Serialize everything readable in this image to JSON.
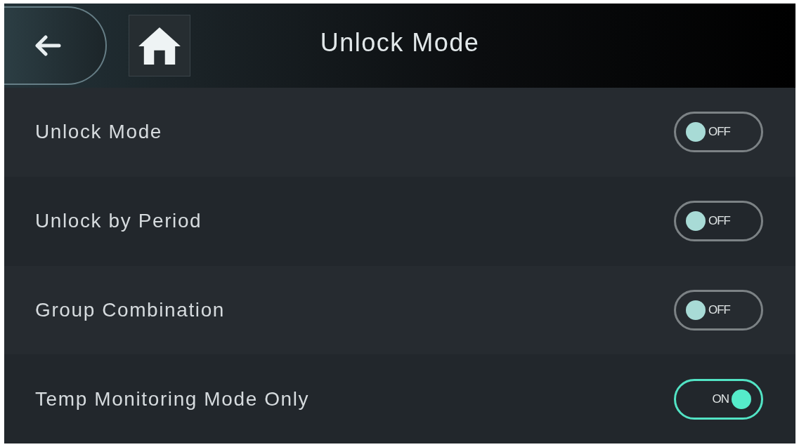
{
  "header": {
    "title": "Unlock Mode"
  },
  "rows": [
    {
      "label": "Unlock Mode",
      "on": false,
      "toggle_text": "OFF"
    },
    {
      "label": "Unlock by Period",
      "on": false,
      "toggle_text": "OFF"
    },
    {
      "label": "Group Combination",
      "on": false,
      "toggle_text": "OFF"
    },
    {
      "label": "Temp Monitoring Mode Only",
      "on": true,
      "toggle_text": "ON"
    }
  ]
}
